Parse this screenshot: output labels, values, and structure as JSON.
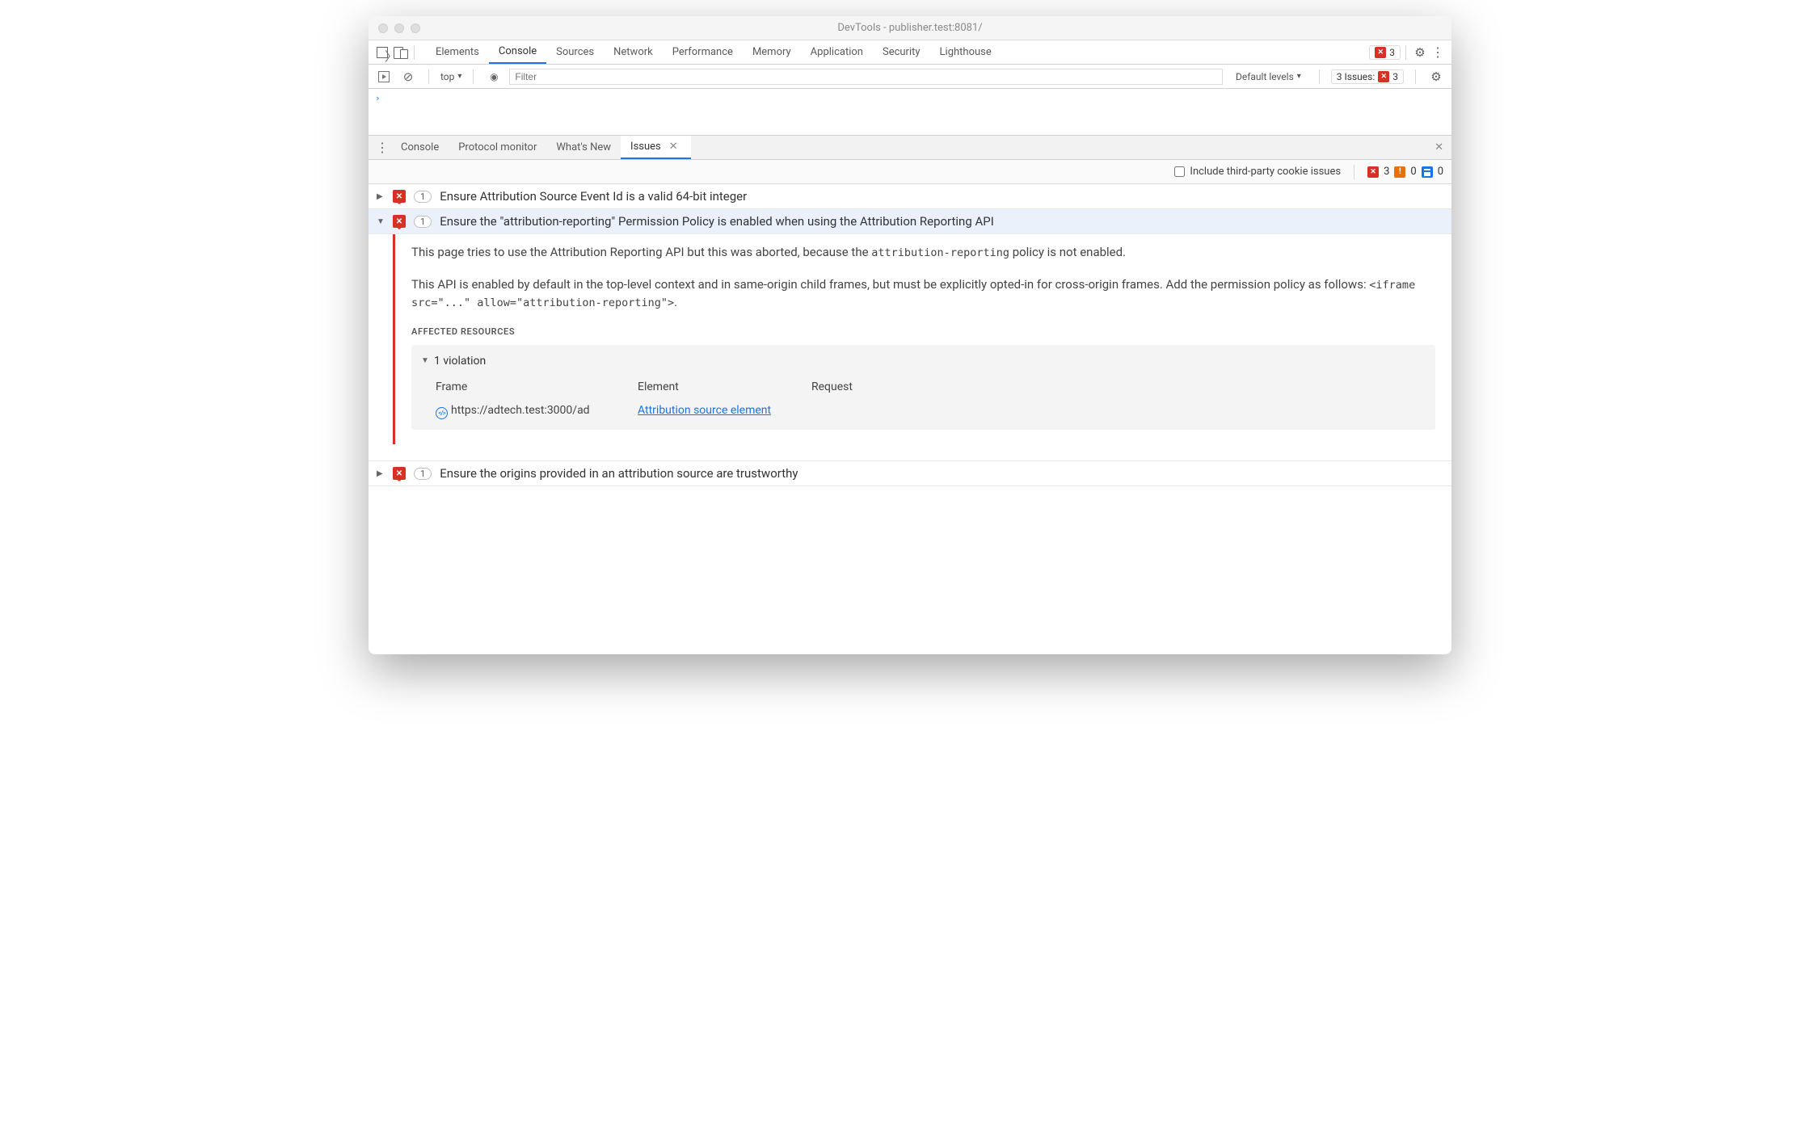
{
  "window": {
    "title": "DevTools - publisher.test:8081/"
  },
  "main_tabs": {
    "items": [
      "Elements",
      "Console",
      "Sources",
      "Network",
      "Performance",
      "Memory",
      "Application",
      "Security",
      "Lighthouse"
    ],
    "active_index": 1,
    "error_count": "3"
  },
  "console_toolbar": {
    "context": "top",
    "filter_placeholder": "Filter",
    "levels_label": "Default levels",
    "issues_prefix": "3 Issues:",
    "issues_count": "3"
  },
  "drawer_tabs": {
    "items": [
      "Console",
      "Protocol monitor",
      "What's New",
      "Issues"
    ],
    "active_index": 3
  },
  "issues_toolbar": {
    "checkbox_label": "Include third-party cookie issues",
    "errors": "3",
    "warnings": "0",
    "info": "0"
  },
  "issues": [
    {
      "count": "1",
      "title": "Ensure Attribution Source Event Id is a valid 64-bit integer"
    },
    {
      "count": "1",
      "title": "Ensure the \"attribution-reporting\" Permission Policy is enabled when using the Attribution Reporting API"
    },
    {
      "count": "1",
      "title": "Ensure the origins provided in an attribution source are trustworthy"
    }
  ],
  "detail": {
    "p1_a": "This page tries to use the Attribution Reporting API but this was aborted, because the ",
    "p1_code": "attribution-reporting",
    "p1_b": " policy is not enabled.",
    "p2_a": "This API is enabled by default in the top-level context and in same-origin child frames, but must be explicitly opted-in for cross-origin frames. Add the permission policy as follows: ",
    "p2_code": "<iframe src=\"...\" allow=\"attribution-reporting\">",
    "p2_b": ".",
    "affected_label": "Affected Resources",
    "violation_label": "1 violation",
    "cols": {
      "c1": "Frame",
      "c2": "Element",
      "c3": "Request"
    },
    "vals": {
      "frame": "https://adtech.test:3000/ad",
      "element": "Attribution source element"
    }
  }
}
